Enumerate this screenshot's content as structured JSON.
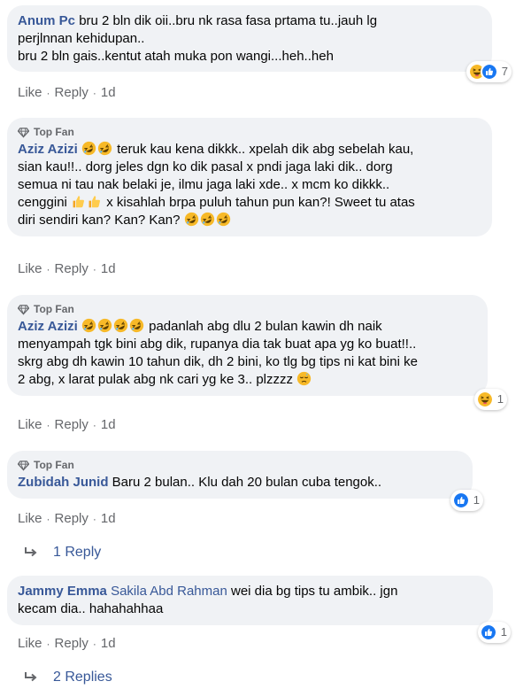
{
  "comments": [
    {
      "author": "Anum Pc",
      "text_1": "bru 2 bln dik oii..bru nk rasa fasa prtama tu..jauh lg",
      "text_2": "perjlnnan kehidupan..",
      "text_3": "bru 2 bln gais..kentut atah muka pon wangi...heh..heh",
      "like": "Like",
      "reply": "Reply",
      "time": "1d",
      "reactions": {
        "icons": [
          "haha-icon",
          "like-icon"
        ],
        "count": "7"
      }
    },
    {
      "badge": "Top Fan",
      "author": "Aziz Azizi",
      "text_1": "teruk kau kena dikkk.. xpelah dik abg sebelah kau,",
      "text_2": "sian kau!!.. dorg jeles dgn ko dik pasal x pndi jaga laki dik.. dorg",
      "text_3": "semua ni tau nak belaki je, ilmu jaga laki xde.. x mcm ko dikkk..",
      "text_4a": "cenggini",
      "text_4b": "x kisahlah brpa puluh tahun pun kan?! Sweet tu atas",
      "text_5": "diri sendiri kan? Kan? Kan?",
      "like": "Like",
      "reply": "Reply",
      "time": "1d"
    },
    {
      "badge": "Top Fan",
      "author": "Aziz Azizi",
      "text_1": "padanlah abg dlu 2 bulan kawin dh naik",
      "text_2": "menyampah tgk bini abg dik, rupanya dia tak buat apa yg ko buat!!..",
      "text_3": "skrg abg dh kawin 10 tahun dik, dh 2 bini, ko tlg bg tips ni kat bini ke",
      "text_4": "2 abg, x larat pulak abg nk cari yg ke 3.. plzzzz",
      "like": "Like",
      "reply": "Reply",
      "time": "1d",
      "reactions": {
        "icons": [
          "haha-icon"
        ],
        "count": "1"
      }
    },
    {
      "badge": "Top Fan",
      "author": "Zubidah Junid",
      "text_1": "Baru 2 bulan.. Klu dah 20 bulan cuba tengok..",
      "like": "Like",
      "reply": "Reply",
      "time": "1d",
      "reactions": {
        "icons": [
          "like-icon"
        ],
        "count": "1"
      },
      "replies_label": "1 Reply"
    },
    {
      "author": "Jammy Emma",
      "mention": "Sakila Abd Rahman",
      "text_1": "wei dia bg tips tu ambik.. jgn",
      "text_2": "kecam dia.. hahahahhaa",
      "like": "Like",
      "reply": "Reply",
      "time": "1d",
      "reactions": {
        "icons": [
          "like-icon"
        ],
        "count": "1"
      },
      "replies_label": "2 Replies"
    }
  ],
  "colors": {
    "bubble": "#f0f2f5",
    "link": "#385898",
    "meta": "#65676b",
    "like_blue": "#1877f2",
    "haha_yellow": "#f7b928"
  }
}
